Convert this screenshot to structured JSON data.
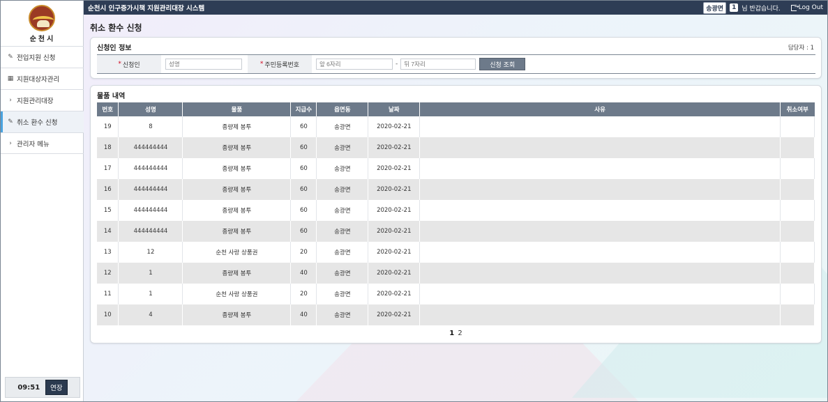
{
  "app": {
    "system_title": "순천시 인구증가시책 지원관리대장 시스템",
    "user": "송광면",
    "user_count": "1",
    "greeting": "님 반갑습니다.",
    "logout": "Log Out"
  },
  "logo": {
    "text": "순천시"
  },
  "sidebar": {
    "items": [
      {
        "icon": "edit-icon",
        "label": "전입지원 신청"
      },
      {
        "icon": "table-icon",
        "label": "지원대상자관리"
      },
      {
        "icon": "chevron-right-icon",
        "label": "지원관리대장"
      },
      {
        "icon": "edit-icon",
        "label": "취소 환수 신청"
      },
      {
        "icon": "chevron-right-icon",
        "label": "관리자 메뉴"
      }
    ],
    "timer": "09:51",
    "extend": "연장"
  },
  "page": {
    "title": "취소 환수 신청"
  },
  "applicant": {
    "section_title": "신청인 정보",
    "manager": "담당자 : 1",
    "name_label": "신청인",
    "name_placeholder": "성명",
    "rrn_label": "주민등록번호",
    "rrn_front_placeholder": "앞 6자리",
    "rrn_back_placeholder": "뒤 7자리",
    "query_button": "신청 조회"
  },
  "items": {
    "section_title": "물품 내역",
    "columns": [
      "번호",
      "성명",
      "물품",
      "지급수",
      "읍면동",
      "날짜",
      "사유",
      "취소여부"
    ],
    "rows": [
      [
        "19",
        "8",
        "종량제 봉투",
        "60",
        "송광면",
        "2020-02-21",
        "",
        ""
      ],
      [
        "18",
        "444444444",
        "종량제 봉투",
        "60",
        "송광면",
        "2020-02-21",
        "",
        ""
      ],
      [
        "17",
        "444444444",
        "종량제 봉투",
        "60",
        "송광면",
        "2020-02-21",
        "",
        ""
      ],
      [
        "16",
        "444444444",
        "종량제 봉투",
        "60",
        "송광면",
        "2020-02-21",
        "",
        ""
      ],
      [
        "15",
        "444444444",
        "종량제 봉투",
        "60",
        "송광면",
        "2020-02-21",
        "",
        ""
      ],
      [
        "14",
        "444444444",
        "종량제 봉투",
        "60",
        "송광면",
        "2020-02-21",
        "",
        ""
      ],
      [
        "13",
        "12",
        "순천 사랑 상품권",
        "20",
        "송광면",
        "2020-02-21",
        "",
        ""
      ],
      [
        "12",
        "1",
        "종량제 봉투",
        "40",
        "송광면",
        "2020-02-21",
        "",
        ""
      ],
      [
        "11",
        "1",
        "순천 사랑 상품권",
        "20",
        "송광면",
        "2020-02-21",
        "",
        ""
      ],
      [
        "10",
        "4",
        "종량제 봉투",
        "40",
        "송광면",
        "2020-02-21",
        "",
        ""
      ]
    ],
    "pages": [
      "1",
      "2"
    ]
  }
}
